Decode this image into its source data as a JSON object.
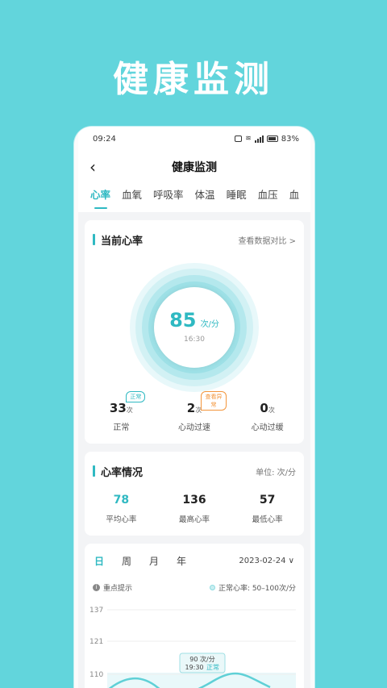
{
  "promo": {
    "title": "健康监测"
  },
  "status": {
    "time": "09:24",
    "battery": "83%"
  },
  "nav": {
    "title": "健康监测",
    "back": "‹"
  },
  "tabs": [
    "心率",
    "血氧",
    "呼吸率",
    "体温",
    "睡眠",
    "血压",
    "血"
  ],
  "current": {
    "title": "当前心率",
    "link": "查看数据对比 >",
    "bpm": "85",
    "unit": "次/分",
    "time": "16:30",
    "stats": [
      {
        "num": "33",
        "unit": "次",
        "label": "正常",
        "badge": "正常"
      },
      {
        "num": "2",
        "unit": "次",
        "label": "心动过速",
        "badge": "查看异常"
      },
      {
        "num": "0",
        "unit": "次",
        "label": "心动过缓"
      }
    ]
  },
  "situation": {
    "title": "心率情况",
    "unit": "单位: 次/分",
    "cells": [
      {
        "num": "78",
        "label": "平均心率"
      },
      {
        "num": "136",
        "label": "最高心率"
      },
      {
        "num": "57",
        "label": "最低心率"
      }
    ]
  },
  "chartcard": {
    "periods": [
      "日",
      "周",
      "月",
      "年"
    ],
    "date": "2023-02-24 ∨",
    "hint": "重点提示",
    "normal": "正常心率: 50–100次/分",
    "tooltip_value": "90 次/分",
    "tooltip_time": "19:30",
    "tooltip_status": "正常"
  },
  "chart_data": {
    "type": "line",
    "y_ticks": [
      "137",
      "121",
      "110"
    ],
    "normal_range": [
      50,
      100
    ],
    "highlight": {
      "time": "19:30",
      "value": 90
    }
  },
  "colors": {
    "accent": "#2fb9c2",
    "background": "#62d5dc",
    "warning": "#f3953b"
  }
}
